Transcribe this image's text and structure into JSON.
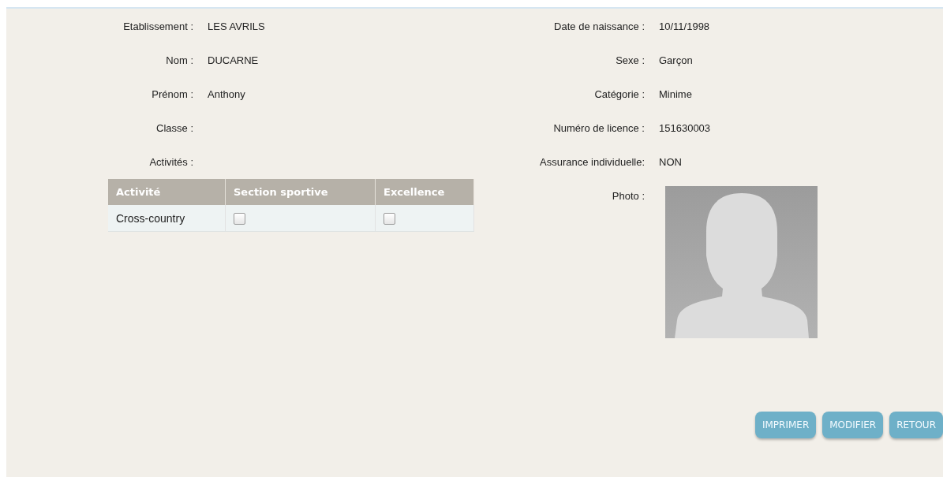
{
  "left_fields": [
    {
      "label": "Etablissement :",
      "value": "LES AVRILS"
    },
    {
      "label": "Nom :",
      "value": "DUCARNE"
    },
    {
      "label": "Prénom :",
      "value": "Anthony"
    },
    {
      "label": "Classe :"
    },
    {
      "label": "Activités :"
    }
  ],
  "right_fields": [
    {
      "label": "Date de naissance :",
      "value": "10/11/1998"
    },
    {
      "label": "Sexe :",
      "value": "Garçon"
    },
    {
      "label": "Catégorie :",
      "value": "Minime"
    },
    {
      "label": "Numéro de licence :",
      "value": "151630003"
    },
    {
      "label": "Assurance individuelle:",
      "value": "NON"
    }
  ],
  "photo_label": "Photo :",
  "activities_table": {
    "columns": [
      "Activité",
      "Section sportive",
      "Excellence"
    ],
    "rows": [
      {
        "activity": "Cross-country",
        "section_sportive": false,
        "excellence": false
      }
    ]
  },
  "buttons": [
    "IMPRIMER",
    "MODIFIER",
    "RETOUR"
  ]
}
